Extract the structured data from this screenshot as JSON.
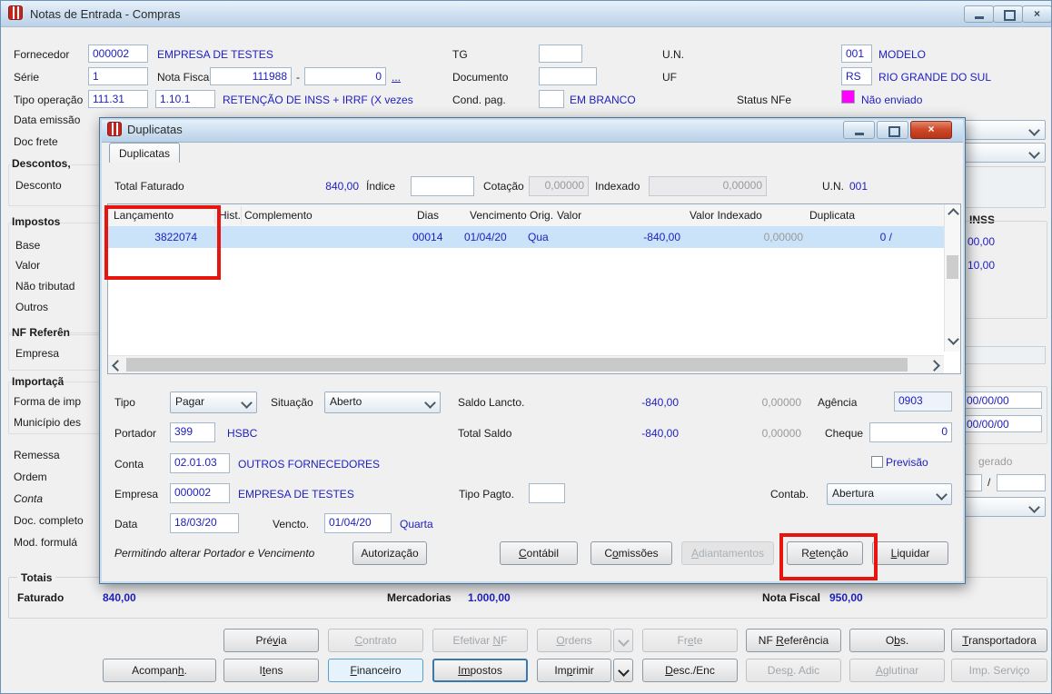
{
  "window": {
    "title": "Notas de Entrada - Compras"
  },
  "form": {
    "fornecedor_label": "Fornecedor",
    "fornecedor_code": "000002",
    "fornecedor_name": "EMPRESA DE TESTES",
    "tg_label": "TG",
    "un_label": "U.N.",
    "un_code": "001",
    "un_name": "MODELO",
    "serie_label": "Série",
    "serie_value": "1",
    "nota_fiscal_label": "Nota Fiscal",
    "nota_fiscal_number": "111988",
    "nota_fiscal_dash": "-",
    "nota_fiscal_suffix": "0",
    "more_link": "...",
    "documento_label": "Documento",
    "uf_label": "UF",
    "uf_code": "RS",
    "uf_name": "RIO GRANDE DO SUL",
    "tipo_operacao_label": "Tipo operação",
    "tipo_operacao_code1": "111.31",
    "tipo_operacao_code2": "1.10.1",
    "tipo_operacao_desc": "RETENÇÃO DE INSS + IRRF (X vezes",
    "cond_pag_label": "Cond. pag.",
    "cond_pag_value": "EM BRANCO",
    "status_nfe_label": "Status NFe",
    "status_nfe_value": "Não enviado",
    "status_nfe_color": "#ff00ff",
    "left_labels": [
      "Data emissão",
      "Doc frete",
      "Descontos,",
      "Desconto",
      "Impostos",
      "Base",
      "Valor",
      "Não tributad",
      "Outros",
      "NF Referên",
      "Empresa",
      "Importaçã",
      "Forma de imp",
      "Município des",
      "Remessa",
      "Ordem",
      "Conta",
      "Doc. completo",
      "Mod. formulá"
    ],
    "right_fragments": {
      "inss": "INSS",
      "v1": "00,00",
      "v2": "10,00",
      "d1": "00/00/00",
      "d2": "00/00/00",
      "gerado": "gerado",
      "slash": "/"
    }
  },
  "totais": {
    "label": "Totais",
    "faturado_label": "Faturado",
    "faturado": "840,00",
    "mercadorias_label": "Mercadorias",
    "mercadorias": "1.000,00",
    "nota_fiscal_label": "Nota Fiscal",
    "nota_fiscal": "950,00"
  },
  "footer": {
    "previa": "Prévia",
    "contrato": "Contrato",
    "efetivar_nf": "Efetivar NF",
    "ordens": "Ordens",
    "frete": "Frete",
    "nf_referencia": "NF Referência",
    "obs": "Obs.",
    "transportadora": "Transportadora",
    "acompanh": "Acompanh.",
    "itens": "Itens",
    "financeiro": "Financeiro",
    "impostos": "Impostos",
    "imprimir": "Imprimir",
    "desc_enc": "Desc./Enc",
    "desp_adic": "Desp. Adic",
    "aglutinar": "Aglutinar",
    "imp_servico": "Imp. Serviço"
  },
  "dialog": {
    "title": "Duplicatas",
    "tab": "Duplicatas",
    "summary": {
      "total_faturado_label": "Total Faturado",
      "total_faturado": "840,00",
      "indice_label": "Índice",
      "cotacao_label": "Cotação",
      "cotacao": "0,00000",
      "indexado_label": "Indexado",
      "indexado": "0,00000",
      "un_label": "U.N.",
      "un": "001"
    },
    "grid": {
      "columns": [
        "Lançamento",
        "Hist.",
        "Complemento",
        "Dias",
        "Vencimento Orig.",
        "Valor",
        "Valor Indexado",
        "Duplicata"
      ],
      "row": {
        "lancamento": "3822074",
        "dias": "00014",
        "vencimento": "01/04/20",
        "dia_semana": "Qua",
        "valor": "-840,00",
        "valor_indexado": "0,00000",
        "duplicata": "0 /"
      }
    },
    "fields": {
      "tipo_label": "Tipo",
      "tipo": "Pagar",
      "situacao_label": "Situação",
      "situacao": "Aberto",
      "saldo_lancto_label": "Saldo Lancto.",
      "saldo_lancto": "-840,00",
      "saldo_lancto_idx": "0,00000",
      "agencia_label": "Agência",
      "agencia": "0903",
      "portador_label": "Portador",
      "portador": "399",
      "portador_nome": "HSBC",
      "total_saldo_label": "Total Saldo",
      "total_saldo": "-840,00",
      "total_saldo_idx": "0,00000",
      "cheque_label": "Cheque",
      "cheque": "0",
      "conta_label": "Conta",
      "conta": "02.01.03",
      "conta_nome": "OUTROS FORNECEDORES",
      "previsao_label": "Previsão",
      "empresa_label": "Empresa",
      "empresa": "000002",
      "empresa_nome": "EMPRESA DE TESTES",
      "tipo_pagto_label": "Tipo Pagto.",
      "contab_label": "Contab.",
      "contab": "Abertura",
      "data_label": "Data",
      "data": "18/03/20",
      "vencto_label": "Vencto.",
      "vencto": "01/04/20",
      "vencto_dia": "Quarta",
      "hint": "Permitindo alterar Portador e Vencimento"
    },
    "buttons": {
      "autorizacao": "Autorização",
      "contabil": "Contábil",
      "comissoes": "Comissões",
      "adiantamentos": "Adiantamentos",
      "retencao": "Retenção",
      "liquidar": "Liquidar"
    }
  },
  "colors": {
    "accent_text": "#2020c0",
    "status_magenta": "#ff00ff",
    "annotation_red": "#e8150f",
    "row_highlight": "#cbe3f8"
  }
}
